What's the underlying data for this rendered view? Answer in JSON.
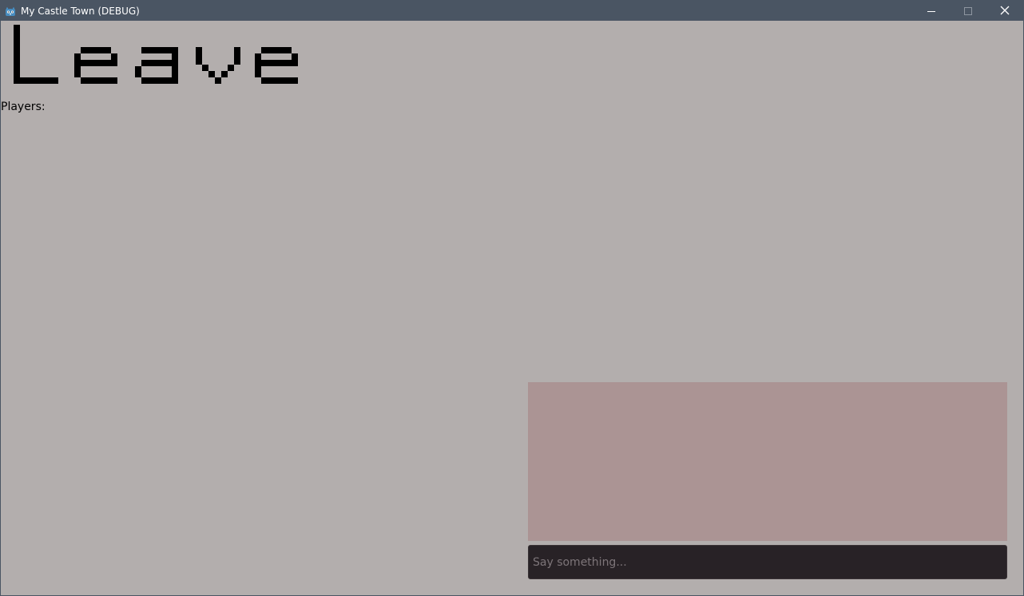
{
  "window": {
    "title": "My Castle Town (DEBUG)",
    "app_icon": "godot-icon",
    "controls": [
      "minimize-icon",
      "maximize-icon",
      "close-icon"
    ]
  },
  "main": {
    "leave_label": "Leave",
    "players_label": "Players:"
  },
  "chat": {
    "input_placeholder": "Say something...",
    "input_value": ""
  },
  "colors": {
    "background": "#b3aead",
    "titlebar": "#4a5563",
    "chat_log": "#ab9494",
    "chat_input": "#282226"
  }
}
